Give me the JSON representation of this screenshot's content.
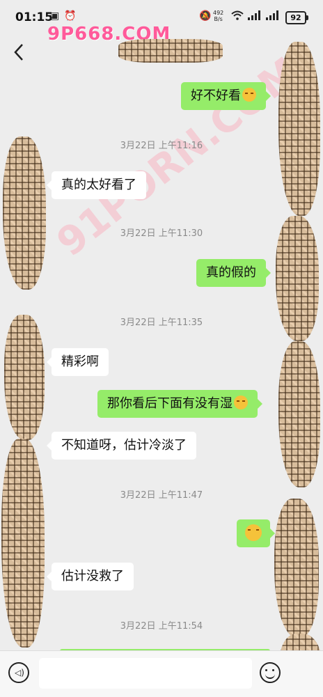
{
  "status": {
    "time": "01:15",
    "net_speed": "492",
    "net_unit": "B/s",
    "battery": "92"
  },
  "watermarks": {
    "top": "9P668.COM",
    "diagonal": "91PORN.COM"
  },
  "messages": [
    {
      "side": "out",
      "text": "好不好看",
      "emoji": true
    },
    {
      "type": "time",
      "text": "3月22日 上午11:16"
    },
    {
      "side": "in",
      "text": "真的太好看了"
    },
    {
      "type": "time",
      "text": "3月22日 上午11:30"
    },
    {
      "side": "out",
      "text": "真的假的"
    },
    {
      "type": "time",
      "text": "3月22日 上午11:35"
    },
    {
      "side": "in",
      "text": "精彩啊"
    },
    {
      "side": "out",
      "text": "那你看后下面有没有湿",
      "emoji": true
    },
    {
      "side": "in",
      "text": "不知道呀，估计冷淡了"
    },
    {
      "type": "time",
      "text": "3月22日 上午11:47"
    },
    {
      "side": "out",
      "text": "",
      "emoji": true
    },
    {
      "side": "in",
      "text": "估计没救了"
    },
    {
      "type": "time",
      "text": "3月22日 上午11:54"
    }
  ],
  "input": {
    "value": "",
    "placeholder": ""
  },
  "colors": {
    "background": "#ededed",
    "out_bubble": "#95ec69",
    "in_bubble": "#ffffff",
    "time_text": "#8a8a8a"
  },
  "icons": [
    "back-arrow-icon",
    "voice-icon",
    "emoji-icon",
    "mute-icon",
    "alarm-icon",
    "wifi-icon",
    "signal-icon",
    "battery-icon"
  ]
}
